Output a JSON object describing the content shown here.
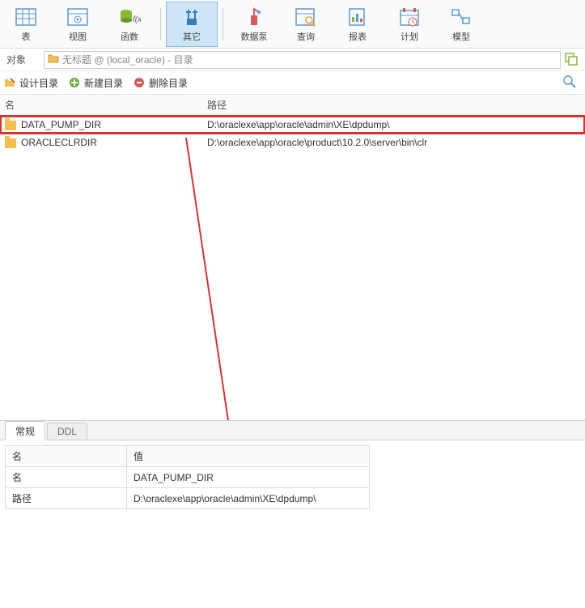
{
  "toolbar": {
    "items": [
      {
        "key": "table",
        "label": "表",
        "color": "#5b9bd5"
      },
      {
        "key": "view",
        "label": "视图",
        "color": "#5b9bd5"
      },
      {
        "key": "function",
        "label": "函数",
        "color": "#8ab833"
      },
      {
        "key": "other",
        "label": "其它",
        "color": "#3a7abd",
        "active": true
      },
      {
        "key": "datapump",
        "label": "数据泵",
        "color": "#d65a5a"
      },
      {
        "key": "query",
        "label": "查询",
        "color": "#5b9bd5"
      },
      {
        "key": "report",
        "label": "报表",
        "color": "#5b9bd5"
      },
      {
        "key": "schedule",
        "label": "计划",
        "color": "#d65a5a"
      },
      {
        "key": "model",
        "label": "模型",
        "color": "#5b9bd5"
      }
    ]
  },
  "address": {
    "label": "对象",
    "text": "无标题 @ (local_oracle) - 目录"
  },
  "actions": {
    "design": "设计目录",
    "new": "新建目录",
    "delete": "删除目录"
  },
  "table": {
    "headers": {
      "name": "名",
      "path": "路径"
    },
    "rows": [
      {
        "name": "DATA_PUMP_DIR",
        "path": "D:\\oraclexe\\app\\oracle\\admin\\XE\\dpdump\\",
        "highlight": true
      },
      {
        "name": "ORACLECLRDIR",
        "path": "D:\\oraclexe\\app\\oracle\\product\\10.2.0\\server\\bin\\clr"
      }
    ]
  },
  "bottom": {
    "tabs": {
      "general": "常规",
      "ddl": "DDL"
    },
    "headers": {
      "name": "名",
      "value": "值"
    },
    "rows": [
      {
        "name": "名",
        "value": "DATA_PUMP_DIR"
      },
      {
        "name": "路径",
        "value": "D:\\oraclexe\\app\\oracle\\admin\\XE\\dpdump\\"
      }
    ]
  }
}
